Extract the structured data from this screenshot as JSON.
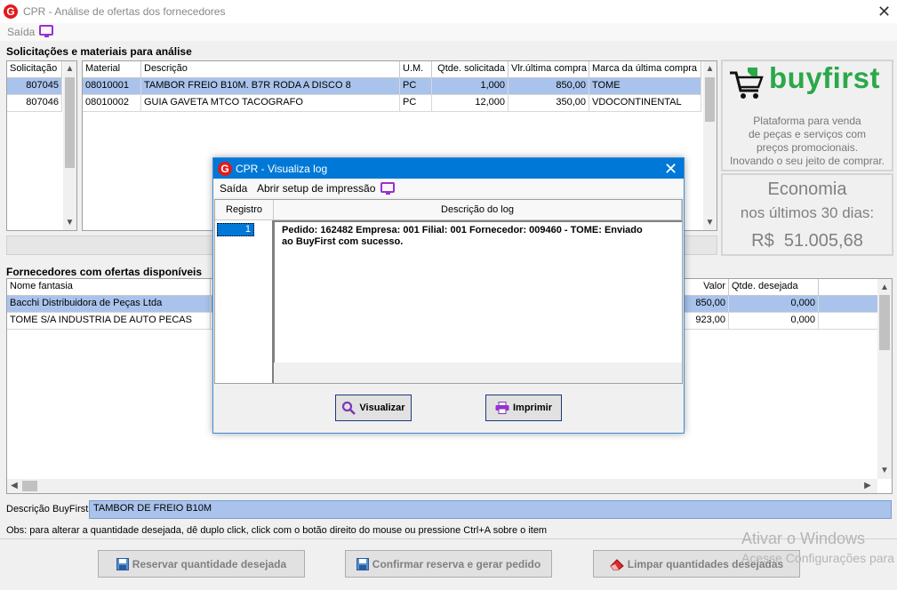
{
  "window": {
    "title": "CPR - Análise de ofertas dos fornecedores"
  },
  "menu": {
    "saida": "Saída"
  },
  "sections": {
    "solicitacoes": "Solicitações e materiais para análise",
    "fornecedores": "Fornecedores com ofertas disponíveis"
  },
  "solicitacao_grid": {
    "header": "Solicitação",
    "rows": [
      "807045",
      "807046"
    ]
  },
  "material_grid": {
    "headers": [
      "Material",
      "Descrição",
      "U.M.",
      "Qtde. solicitada",
      "Vlr.última compra",
      "Marca da última compra"
    ],
    "rows": [
      [
        "08010001",
        "TAMBOR FREIO B10M. B7R RODA A DISCO 8",
        "PC",
        "1,000",
        "850,00",
        "TOME"
      ],
      [
        "08010002",
        "GUIA GAVETA MTCO TACOGRAFO",
        "PC",
        "12,000",
        "350,00",
        "VDOCONTINENTAL"
      ]
    ]
  },
  "buyfirst": {
    "logo": "buyfirst",
    "tagline_1": "Plataforma para venda",
    "tagline_2": "de peças e serviços com",
    "tagline_3": "preços promocionais.",
    "tagline_4": "Inovando o seu jeito de comprar.",
    "economia": "Economia",
    "periodo": "nos últimos 30 dias:",
    "valor": "R$  51.005,68"
  },
  "fornecedor_grid": {
    "headers": [
      "Nome fantasia",
      "Valor",
      "Qtde. desejada"
    ],
    "rows": [
      [
        "Bacchi Distribuidora de Peças Ltda",
        "850,00",
        "0,000"
      ],
      [
        "TOME S/A INDUSTRIA DE AUTO PECAS",
        "923,00",
        "0,000"
      ]
    ]
  },
  "descricao": {
    "label": "Descrição BuyFirst",
    "value": "TAMBOR DE FREIO B10M"
  },
  "obs": "Obs: para alterar a quantidade desejada, dê duplo click, click com o botão direito do mouse ou pressione Ctrl+A sobre o item",
  "buttons": {
    "reservar": "Reservar quantidade desejada",
    "confirmar": "Confirmar reserva e gerar pedido",
    "limpar": "Limpar quantidades desejadas"
  },
  "dialog": {
    "title": "CPR - Visualiza log",
    "menu_saida": "Saída",
    "menu_setup": "Abrir setup de impressão",
    "col_registro": "Registro",
    "col_descricao": "Descrição do log",
    "registro": "1",
    "log_line_1": "Pedido: 162482 Empresa: 001 Filial: 001 Fornecedor: 009460 - TOME: Enviado",
    "log_line_2": "ao BuyFirst com sucesso.",
    "btn_visualizar": "Visualizar",
    "btn_imprimir": "Imprimir"
  },
  "watermark": {
    "line1": "Ativar o Windows",
    "line2": "Acesse Configurações para"
  },
  "colors": {
    "selection": "#a9c3ec",
    "dialog_titlebar": "#0078d7",
    "brand_green": "#2aa84a",
    "logo_red": "#e21a1a"
  }
}
